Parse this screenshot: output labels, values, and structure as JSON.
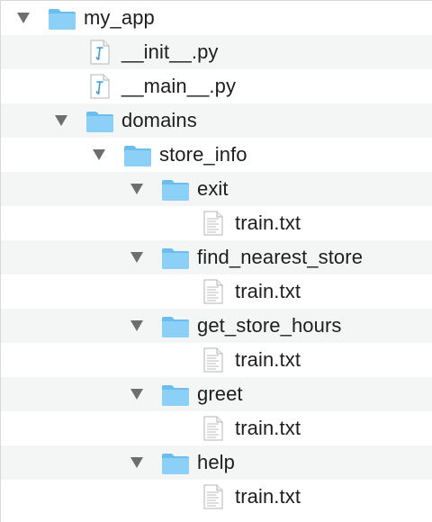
{
  "icons": {
    "expanded": "triangle-down-icon",
    "folder": "folder-icon",
    "python_file": "python-file-icon",
    "text_file": "text-file-icon"
  },
  "colors": {
    "folder_fill": "#8dd0f7",
    "folder_tab": "#6bbdee",
    "alt_row": "#f4f5f5",
    "text": "#1e1e1e",
    "triangle": "#6e6e6e"
  },
  "tree": {
    "rows": [
      {
        "label": "my_app",
        "kind": "folder",
        "depth": 0,
        "expanded": true
      },
      {
        "label": "__init__.py",
        "kind": "python",
        "depth": 1
      },
      {
        "label": "__main__.py",
        "kind": "python",
        "depth": 1
      },
      {
        "label": "domains",
        "kind": "folder",
        "depth": 1,
        "expanded": true
      },
      {
        "label": "store_info",
        "kind": "folder",
        "depth": 2,
        "expanded": true
      },
      {
        "label": "exit",
        "kind": "folder",
        "depth": 3,
        "expanded": true
      },
      {
        "label": "train.txt",
        "kind": "text",
        "depth": 4
      },
      {
        "label": "find_nearest_store",
        "kind": "folder",
        "depth": 3,
        "expanded": true
      },
      {
        "label": "train.txt",
        "kind": "text",
        "depth": 4
      },
      {
        "label": "get_store_hours",
        "kind": "folder",
        "depth": 3,
        "expanded": true
      },
      {
        "label": "train.txt",
        "kind": "text",
        "depth": 4
      },
      {
        "label": "greet",
        "kind": "folder",
        "depth": 3,
        "expanded": true
      },
      {
        "label": "train.txt",
        "kind": "text",
        "depth": 4
      },
      {
        "label": "help",
        "kind": "folder",
        "depth": 3,
        "expanded": true
      },
      {
        "label": "train.txt",
        "kind": "text",
        "depth": 4
      }
    ]
  }
}
